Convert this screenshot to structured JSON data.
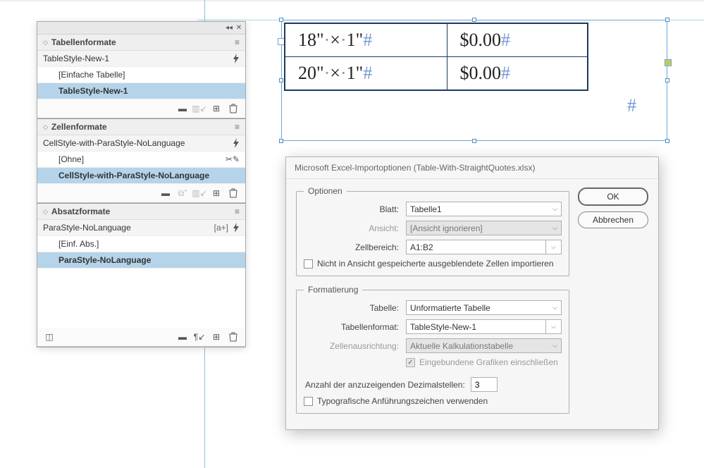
{
  "panels": {
    "tableFormats": {
      "title": "Tabellenformate",
      "applied": "TableStyle-New-1",
      "items": [
        {
          "label": "[Einfache Tabelle]",
          "selected": false
        },
        {
          "label": "TableStyle-New-1",
          "selected": true
        }
      ]
    },
    "cellFormats": {
      "title": "Zellenformate",
      "applied": "CellStyle-with-ParaStyle-NoLanguage",
      "items": [
        {
          "label": "[Ohne]",
          "selected": false,
          "iconRight": true
        },
        {
          "label": "CellStyle-with-ParaStyle-NoLanguage",
          "selected": true
        }
      ]
    },
    "paraFormats": {
      "title": "Absatzformate",
      "applied": "ParaStyle-NoLanguage",
      "appliedSuffix": "[a+]",
      "items": [
        {
          "label": "[Einf. Abs.]",
          "selected": false
        },
        {
          "label": "ParaStyle-NoLanguage",
          "selected": true
        }
      ]
    }
  },
  "artboard": {
    "cells": {
      "r1c1a": "18\"",
      "r1c1b": "1\"",
      "r2c1a": "20\"",
      "r2c1b": "1\"",
      "r1c2": "$0.00",
      "r2c2": "$0.00",
      "sep": "×",
      "dot": "·",
      "hash": "#"
    }
  },
  "dialog": {
    "title": "Microsoft Excel-Importoptionen (Table-With-StraightQuotes.xlsx)",
    "options": {
      "legend": "Optionen",
      "sheetLabel": "Blatt:",
      "sheetValue": "Tabelle1",
      "viewLabel": "Ansicht:",
      "viewValue": "[Ansicht ignorieren]",
      "rangeLabel": "Zellbereich:",
      "rangeValue": "A1:B2",
      "hiddenCellsLabel": "Nicht in Ansicht gespeicherte ausgeblendete Zellen importieren"
    },
    "formatting": {
      "legend": "Formatierung",
      "tableLabel": "Tabelle:",
      "tableValue": "Unformatierte Tabelle",
      "tableFormatLabel": "Tabellenformat:",
      "tableFormatValue": "TableStyle-New-1",
      "cellAlignLabel": "Zellenausrichtung:",
      "cellAlignValue": "Aktuelle Kalkulationstabelle",
      "embedGraphicsLabel": "Eingebundene Grafiken einschließen",
      "decimalsLabel": "Anzahl der anzuzeigenden Dezimalstellen:",
      "decimalsValue": "3",
      "typoQuotesLabel": "Typografische Anführungszeichen verwenden"
    },
    "buttons": {
      "ok": "OK",
      "cancel": "Abbrechen"
    }
  }
}
